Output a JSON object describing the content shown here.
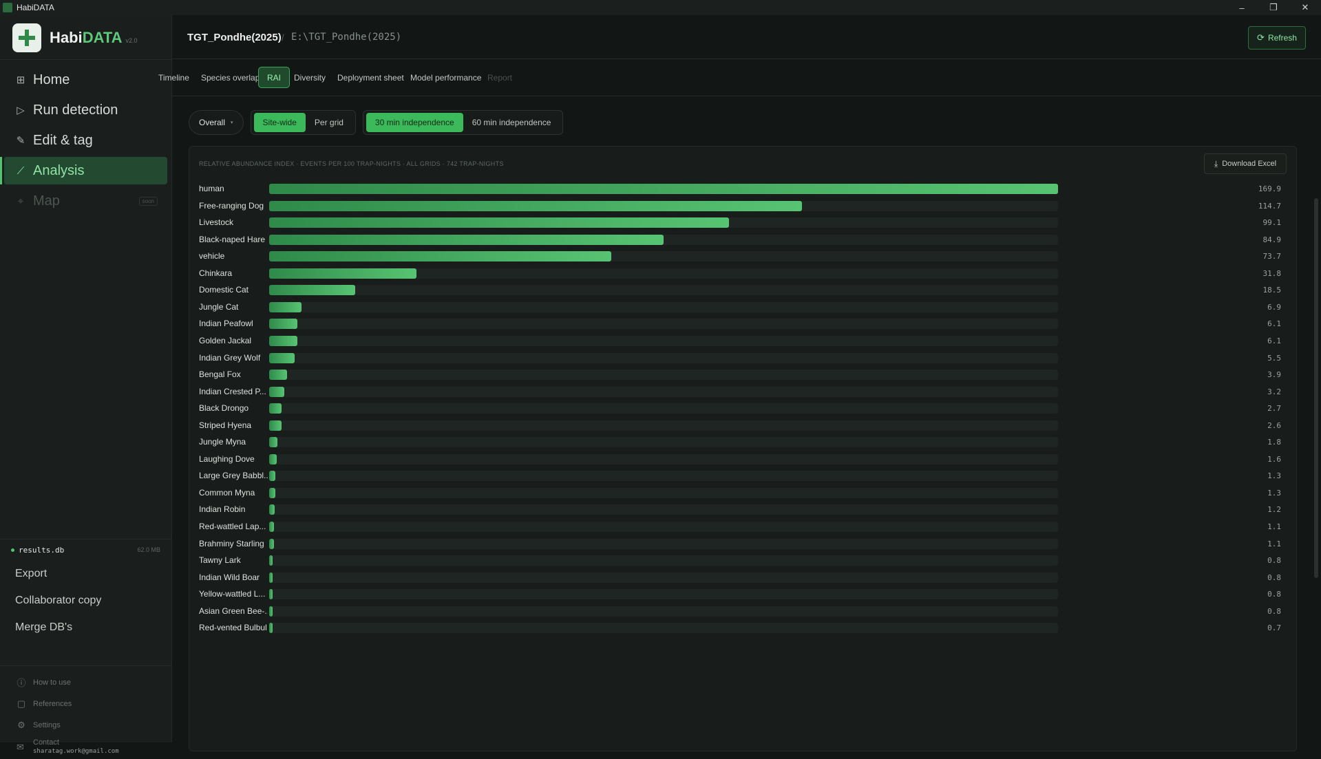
{
  "window": {
    "title": "HabiDATA",
    "controls": [
      "–",
      "❐",
      "✕"
    ]
  },
  "brand": {
    "name_part1": "Habi",
    "name_part2": "DATA",
    "version": "v2.0"
  },
  "nav": [
    {
      "label": "Home",
      "icon": "grid-icon",
      "glyph": "⊞",
      "state": "normal"
    },
    {
      "label": "Run detection",
      "icon": "play-icon",
      "glyph": "▷",
      "state": "normal"
    },
    {
      "label": "Edit & tag",
      "icon": "pencil-icon",
      "glyph": "✎",
      "state": "normal"
    },
    {
      "label": "Analysis",
      "icon": "chart-icon",
      "glyph": "⟋",
      "state": "active"
    },
    {
      "label": "Map",
      "icon": "pin-icon",
      "glyph": "⌖",
      "state": "disabled",
      "badge": "soon"
    }
  ],
  "database": {
    "name": "results.db",
    "size": "62.0 MB"
  },
  "db_actions": [
    "Export",
    "Collaborator copy",
    "Merge DB's"
  ],
  "help": [
    {
      "label": "How to use",
      "icon": "info-icon",
      "glyph": "ⓘ"
    },
    {
      "label": "References",
      "icon": "book-icon",
      "glyph": "▢"
    },
    {
      "label": "Settings",
      "icon": "gear-icon",
      "glyph": "⚙"
    }
  ],
  "contact": {
    "label": "Contact",
    "email": "sharatag.work@gmail.com"
  },
  "header": {
    "project": "TGT_Pondhe(2025)",
    "separator": "/",
    "path": "E:\\TGT_Pondhe(2025)",
    "refresh_label": "Refresh"
  },
  "tabs": [
    {
      "label": "Timeline",
      "state": "normal"
    },
    {
      "label": "Species overlap",
      "state": "normal"
    },
    {
      "label": "RAI",
      "state": "active"
    },
    {
      "label": "Diversity",
      "state": "normal"
    },
    {
      "label": "Deployment sheet",
      "state": "normal"
    },
    {
      "label": "Model performance",
      "state": "normal"
    },
    {
      "label": "Report",
      "state": "disabled"
    }
  ],
  "controls": {
    "scope_select": "Overall",
    "scope": [
      "Site-wide",
      "Per grid"
    ],
    "scope_selected": 0,
    "independence": [
      "30 min independence",
      "60 min independence"
    ],
    "independence_selected": 0
  },
  "panel": {
    "caption": "RELATIVE ABUNDANCE INDEX · EVENTS PER 100 TRAP-NIGHTS · ALL GRIDS · 742 TRAP-NIGHTS",
    "download_label": "Download Excel"
  },
  "chart_data": {
    "type": "bar",
    "orientation": "horizontal",
    "xlim": [
      0,
      169.9
    ],
    "categories": [
      "human",
      "Free-ranging Dog",
      "Livestock",
      "Black-naped Hare",
      "vehicle",
      "Chinkara",
      "Domestic Cat",
      "Jungle Cat",
      "Indian Peafowl",
      "Golden Jackal",
      "Indian Grey Wolf",
      "Bengal Fox",
      "Indian Crested P...",
      "Black Drongo",
      "Striped Hyena",
      "Jungle Myna",
      "Laughing Dove",
      "Large Grey Babbl...",
      "Common Myna",
      "Indian Robin",
      "Red-wattled Lap...",
      "Brahminy Starling",
      "Tawny Lark",
      "Indian Wild Boar",
      "Yellow-wattled L...",
      "Asian Green Bee-...",
      "Red-vented Bulbul"
    ],
    "values": [
      169.9,
      114.7,
      99.1,
      84.9,
      73.7,
      31.8,
      18.5,
      6.9,
      6.1,
      6.1,
      5.5,
      3.9,
      3.2,
      2.7,
      2.6,
      1.8,
      1.6,
      1.3,
      1.3,
      1.2,
      1.1,
      1.1,
      0.8,
      0.8,
      0.8,
      0.8,
      0.7
    ],
    "labels": [
      "169.9",
      "114.7",
      "99.1",
      "84.9",
      "73.7",
      "31.8",
      "18.5",
      "6.9",
      "6.1",
      "6.1",
      "5.5",
      "3.9",
      "3.2",
      "2.7",
      "2.6",
      "1.8",
      "1.6",
      "1.3",
      "1.3",
      "1.2",
      "1.1",
      "1.1",
      "0.8",
      "0.8",
      "0.8",
      "0.8",
      "0.7"
    ]
  }
}
